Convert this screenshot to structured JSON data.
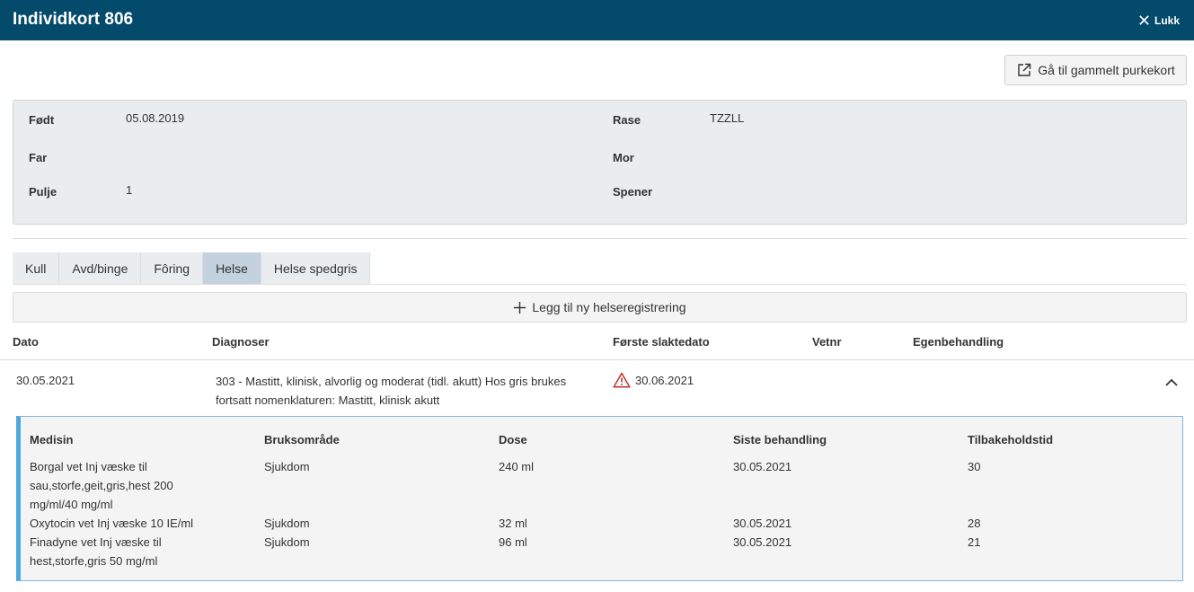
{
  "header": {
    "title": "Individkort 806",
    "close_label": "Lukk"
  },
  "actions": {
    "old_card_label": "Gå til gammelt purkekort",
    "add_health_label": "Legg til ny helseregistrering"
  },
  "info": {
    "fodt_label": "Født",
    "fodt_value": "05.08.2019",
    "far_label": "Far",
    "far_value": "",
    "pulje_label": "Pulje",
    "pulje_value": "1",
    "rase_label": "Rase",
    "rase_value": "TZZLL",
    "mor_label": "Mor",
    "mor_value": "",
    "spener_label": "Spener",
    "spener_value": ""
  },
  "tabs": [
    {
      "label": "Kull",
      "active": false
    },
    {
      "label": "Avd/binge",
      "active": false
    },
    {
      "label": "Fôring",
      "active": false
    },
    {
      "label": "Helse",
      "active": true
    },
    {
      "label": "Helse spedgris",
      "active": false
    }
  ],
  "health_table": {
    "columns": [
      "Dato",
      "Diagnoser",
      "Første slaktedato",
      "Vetnr",
      "Egenbehandling"
    ],
    "rows": [
      {
        "dato": "30.05.2021",
        "diagnose": "303 - Mastitt, klinisk, alvorlig og moderat (tidl. akutt) Hos gris brukes fortsatt nomenklaturen: Mastitt, klinisk akutt",
        "forste_slaktedato": "30.06.2021",
        "vetnr": "",
        "egenbehandling": ""
      }
    ]
  },
  "medicine_table": {
    "columns": [
      "Medisin",
      "Bruksområde",
      "Dose",
      "Siste behandling",
      "Tilbakeholdstid"
    ],
    "rows": [
      {
        "medisin": "Borgal vet Inj væske til sau,storfe,geit,gris,hest 200 mg/ml/40 mg/ml",
        "bruksomrade": "Sjukdom",
        "dose": "240 ml",
        "siste": "30.05.2021",
        "tilbake": "30"
      },
      {
        "medisin": "Oxytocin vet Inj væske 10 IE/ml",
        "bruksomrade": "Sjukdom",
        "dose": "32 ml",
        "siste": "30.05.2021",
        "tilbake": "28"
      },
      {
        "medisin": "Finadyne vet Inj væske til hest,storfe,gris 50 mg/ml",
        "bruksomrade": "Sjukdom",
        "dose": "96 ml",
        "siste": "30.05.2021",
        "tilbake": "21"
      }
    ]
  },
  "colors": {
    "header_bg": "#044a6b",
    "warning": "#c0312b",
    "accent_border": "#4fa8dc"
  },
  "icons": {
    "close": "close-icon",
    "external": "external-link-icon",
    "plus": "plus-icon",
    "warning": "warning-triangle-icon",
    "chevron": "chevron-up-icon"
  }
}
